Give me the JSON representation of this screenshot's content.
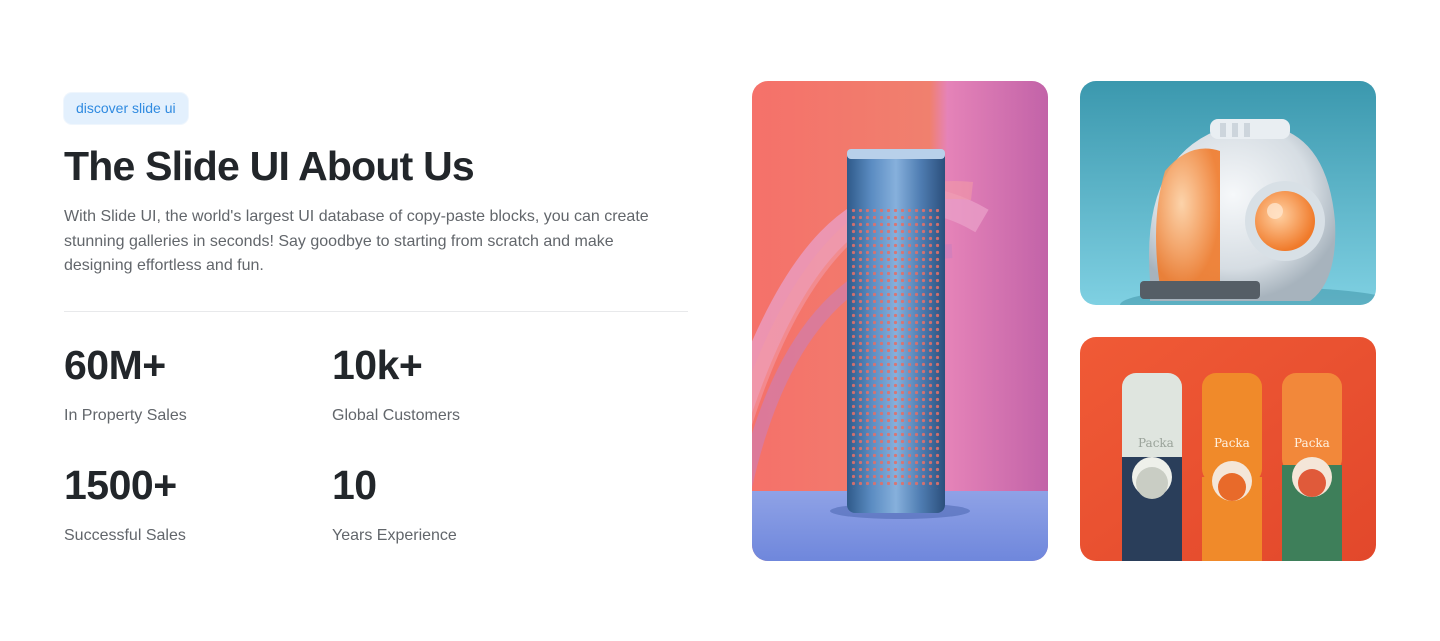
{
  "badge": "discover slide ui",
  "title": "The Slide UI About Us",
  "description": "With Slide UI, the world's largest UI database of copy-paste blocks, you can create stunning galleries in seconds! Say goodbye to starting from scratch and make designing effortless and fun.",
  "stats": [
    {
      "value": "60M+",
      "label": "In Property Sales"
    },
    {
      "value": "10k+",
      "label": "Global Customers"
    },
    {
      "value": "1500+",
      "label": "Successful Sales"
    },
    {
      "value": "10",
      "label": "Years Experience"
    }
  ],
  "bottle_labels": [
    "Packa",
    "Packa",
    "Packa"
  ],
  "colors": {
    "badge_bg": "#e3f0fd",
    "badge_text": "#2f8ae0",
    "heading": "#22262a",
    "body_text": "#62666b"
  }
}
